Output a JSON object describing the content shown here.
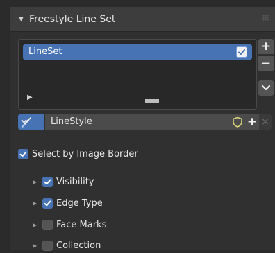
{
  "panel": {
    "title": "Freestyle Line Set",
    "collapse_icon": "triangle-down-icon"
  },
  "lineset_list": {
    "items": [
      {
        "label": "LineSet",
        "checked": true
      }
    ]
  },
  "side_buttons": {
    "add_label": "+",
    "remove_label": "−",
    "specials_icon": "chevron-down-icon"
  },
  "linestyle": {
    "brush_icon": "brush-icon",
    "name": "LineStyle",
    "fake_user_icon": "shield-icon",
    "new_label": "+",
    "unlink_label": "×"
  },
  "options": {
    "select_by_image_border": {
      "label": "Select by Image Border",
      "checked": true
    },
    "visibility": {
      "label": "Visibility",
      "checked": true
    },
    "edge_type": {
      "label": "Edge Type",
      "checked": true
    },
    "face_marks": {
      "label": "Face Marks",
      "checked": false
    },
    "collection": {
      "label": "Collection",
      "checked": false
    }
  },
  "colors": {
    "accent": "#4772b3",
    "panel_bg": "#303030",
    "header_bg": "#3d3d3d",
    "fake_user_shield": "#d8d27a"
  }
}
